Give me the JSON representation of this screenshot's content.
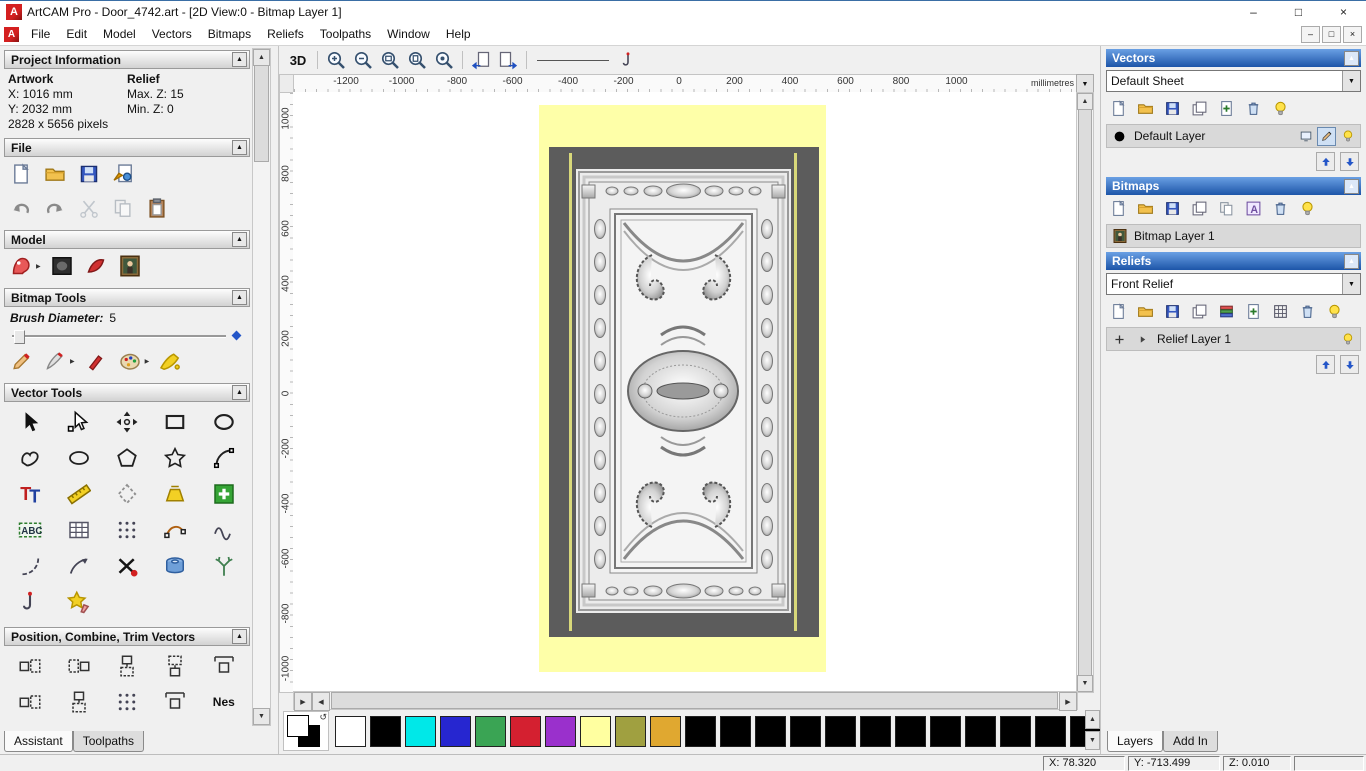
{
  "titlebar": {
    "title": "ArtCAM Pro - Door_4742.art - [2D View:0 - Bitmap Layer 1]"
  },
  "menu": {
    "items": [
      "File",
      "Edit",
      "Model",
      "Vectors",
      "Bitmaps",
      "Reliefs",
      "Toolpaths",
      "Window",
      "Help"
    ]
  },
  "assistant": {
    "project_information": {
      "title": "Project Information",
      "artwork_heading": "Artwork",
      "relief_heading": "Relief",
      "x": "X: 1016 mm",
      "y": "Y: 2032 mm",
      "max_z": "Max. Z: 15",
      "min_z": "Min. Z: 0",
      "pixels": "2828 x 5656 pixels"
    },
    "file_section": "File",
    "model_section": "Model",
    "bitmap_tools_section": "Bitmap Tools",
    "brush_diameter_label": "Brush Diameter:",
    "brush_diameter_value": "5",
    "vector_tools_section": "Vector Tools",
    "position_section": "Position, Combine, Trim Vectors",
    "nesting_label": "Nes",
    "tabs": [
      "Assistant",
      "Toolpaths"
    ]
  },
  "view": {
    "toolbar": {
      "view_3d": "3D"
    },
    "ruler_units": "millimetres",
    "ruler_h": [
      "-1200",
      "-1000",
      "-800",
      "-600",
      "-400",
      "-200",
      "0",
      "200",
      "400",
      "600",
      "800",
      "1000"
    ],
    "ruler_v": [
      "1000",
      "800",
      "600",
      "400",
      "200",
      "0",
      "-200",
      "-400",
      "-600",
      "-800",
      "-1000"
    ]
  },
  "palette": {
    "colors": [
      "#ffffff",
      "#000000",
      "#00e8e8",
      "#2626d0",
      "#3aa454",
      "#d42030",
      "#9a30cc",
      "#ffffa0",
      "#a0a040",
      "#e0a830",
      "#000000",
      "#000000",
      "#000000",
      "#000000",
      "#000000",
      "#000000",
      "#000000",
      "#000000",
      "#000000",
      "#000000",
      "#000000",
      "#000000"
    ]
  },
  "layers_panel": {
    "vectors": {
      "title": "Vectors",
      "sheet_selector": "Default Sheet",
      "layer_name": "Default Layer"
    },
    "bitmaps": {
      "title": "Bitmaps",
      "layer_name": "Bitmap Layer 1"
    },
    "reliefs": {
      "title": "Reliefs",
      "relief_selector": "Front Relief",
      "layer_name": "Relief Layer 1"
    },
    "tabs": [
      "Layers",
      "Add In"
    ]
  },
  "statusbar": {
    "x": "X: 78.320",
    "y": "Y: -713.499",
    "z": "Z: 0.010"
  }
}
